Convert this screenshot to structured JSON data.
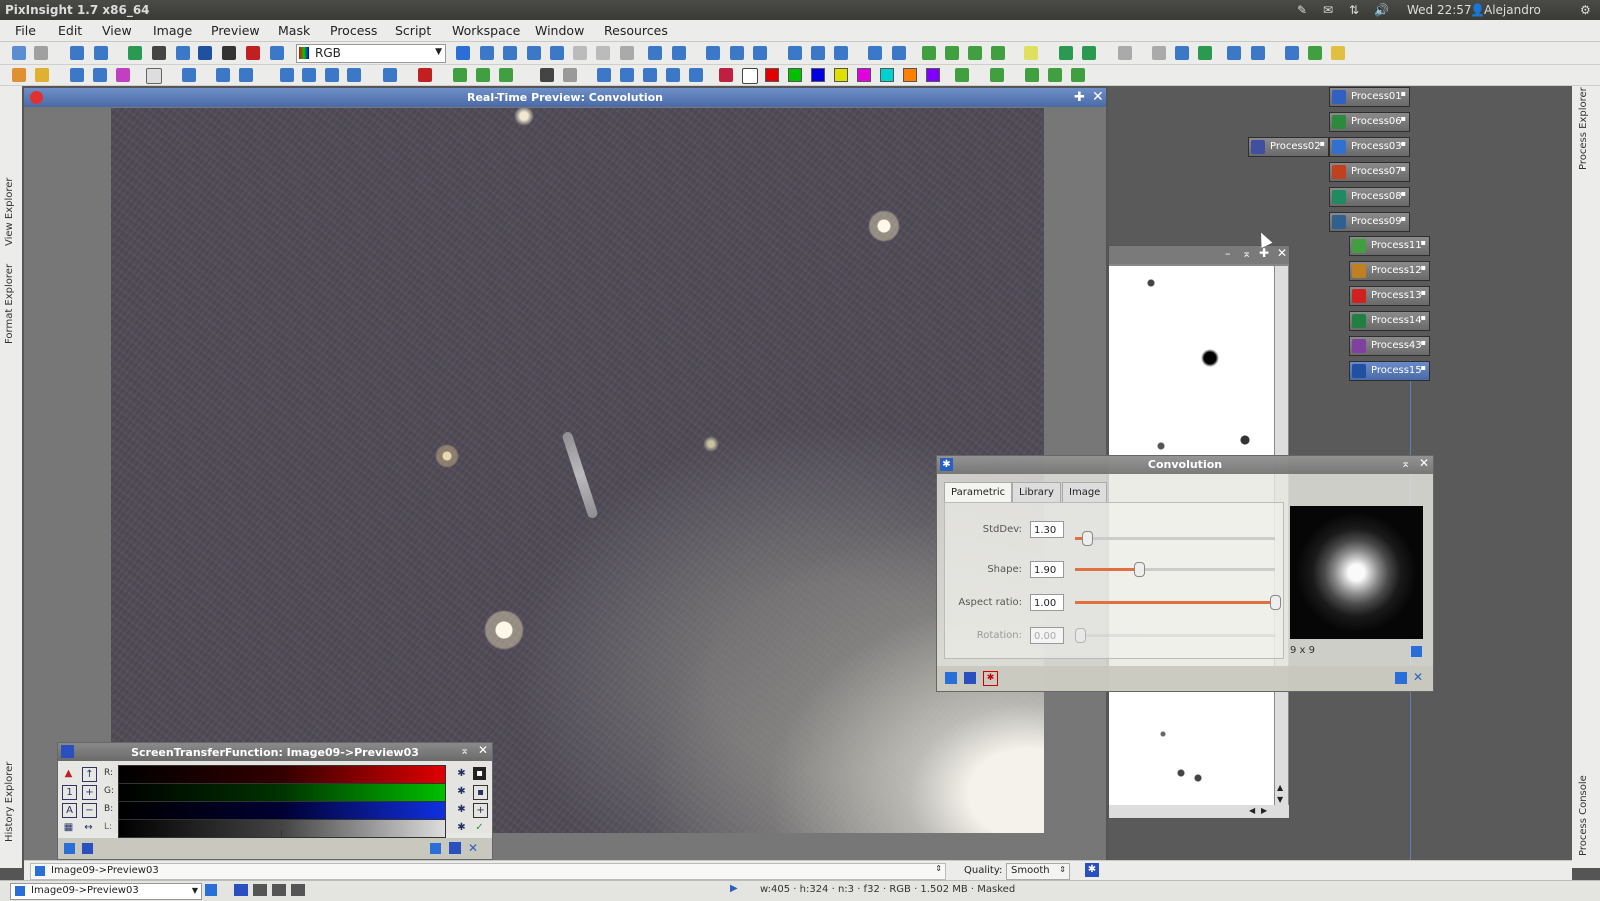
{
  "topbar": {
    "app_title": "PixInsight 1.7 x86_64",
    "clock": "Wed 22:57",
    "user": "Alejandro"
  },
  "menubar": {
    "items": [
      "File",
      "Edit",
      "View",
      "Image",
      "Preview",
      "Mask",
      "Process",
      "Script",
      "Workspace",
      "Window",
      "Resources"
    ]
  },
  "toolbar": {
    "channel_select": "RGB",
    "color_swatches": [
      "#e00000",
      "#00c000",
      "#0000e0",
      "#e0e000",
      "#e000e0",
      "#00d0d0",
      "#ff8000",
      "#8000ff"
    ]
  },
  "left_sidebar": {
    "view_explorer": "View Explorer",
    "format_explorer": "Format Explorer",
    "history_explorer": "History Explorer"
  },
  "right_sidebar": {
    "process_explorer": "Process Explorer",
    "process_console": "Process Console"
  },
  "preview_window": {
    "title": "Real-Time Preview: Convolution"
  },
  "process_icons": [
    {
      "label": "Process01",
      "color": "#3060c0"
    },
    {
      "label": "Process06",
      "color": "#2c8a3c"
    },
    {
      "label": "Process02",
      "color": "#4050a0"
    },
    {
      "label": "Process03",
      "color": "#3070d0"
    },
    {
      "label": "Process07",
      "color": "#c04020"
    },
    {
      "label": "Process08",
      "color": "#208a60"
    },
    {
      "label": "Process09",
      "color": "#306090"
    },
    {
      "label": "Process11",
      "color": "#40a040"
    },
    {
      "label": "Process12",
      "color": "#c08020"
    },
    {
      "label": "Process13",
      "color": "#d02020"
    },
    {
      "label": "Process14",
      "color": "#208040"
    },
    {
      "label": "Process43",
      "color": "#8040a0"
    },
    {
      "label": "Process15",
      "color": "#2050a0"
    }
  ],
  "convolution": {
    "title": "Convolution",
    "tabs": [
      "Parametric",
      "Library",
      "Image"
    ],
    "active_tab": "Parametric",
    "stddev_label": "StdDev:",
    "stddev": "1.30",
    "shape_label": "Shape:",
    "shape": "1.90",
    "aspect_label": "Aspect ratio:",
    "aspect": "1.00",
    "rotation_label": "Rotation:",
    "rotation": "0.00",
    "kernel_size": "9 x 9",
    "stddev_level": 0.06,
    "shape_level": 0.32,
    "aspect_level": 1.0,
    "rotation_level": 0.0
  },
  "stf": {
    "title": "ScreenTransferFunction: Image09->Preview03",
    "channels": [
      "R:",
      "G:",
      "B:",
      "L:"
    ],
    "colors": [
      "#e00000",
      "#00c000",
      "#1030e0",
      "#cccccc"
    ]
  },
  "bottom": {
    "view_name": "Image09->Preview03",
    "quality_label": "Quality:",
    "quality_value": "Smooth",
    "view_selector": "Image09->Preview03",
    "status": "w:405 · h:324 · n:3 · f32 · RGB · 1.502 MB · Masked"
  }
}
